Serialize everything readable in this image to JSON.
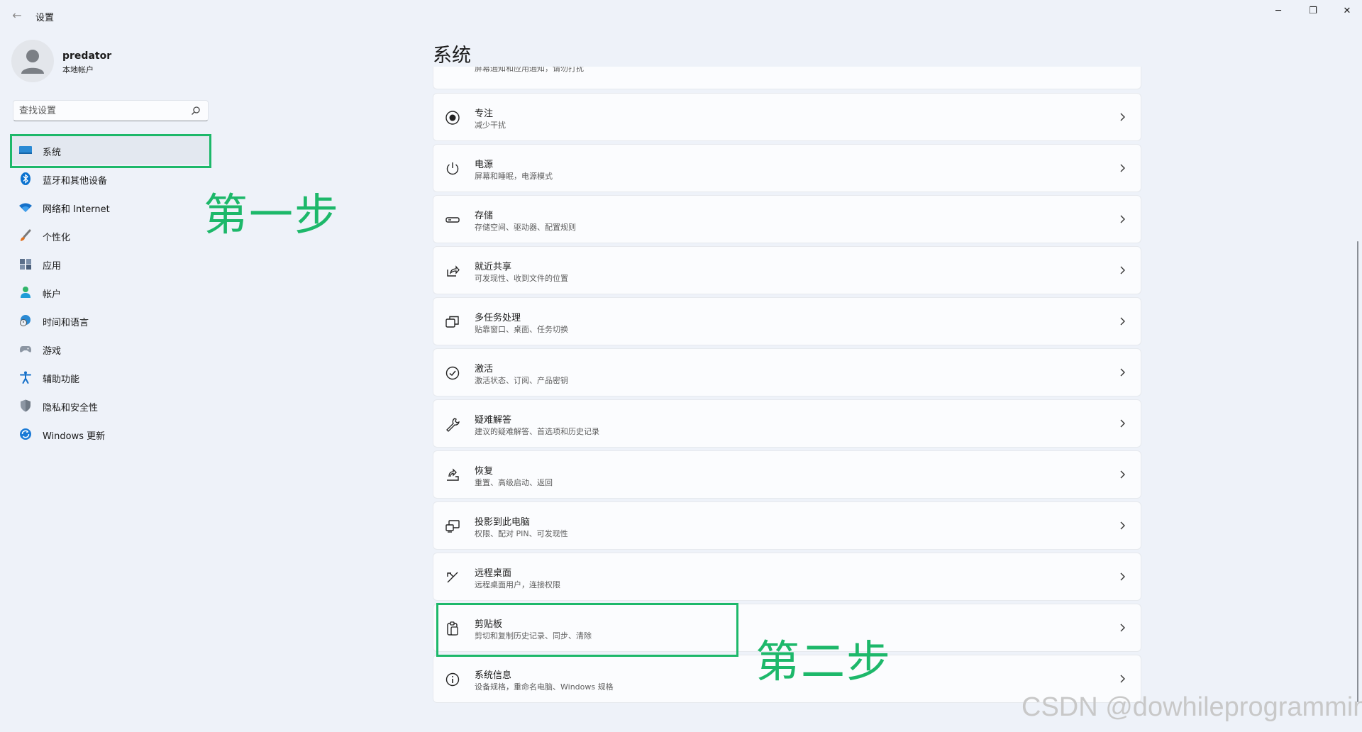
{
  "window": {
    "title": "设置",
    "minimize": "─",
    "maximize": "❐",
    "close": "✕"
  },
  "user": {
    "name": "predator",
    "account_type": "本地帐户"
  },
  "search": {
    "placeholder": "查找设置"
  },
  "sidebar": {
    "items": [
      {
        "label": "系统",
        "icon": "system-icon",
        "selected": true
      },
      {
        "label": "蓝牙和其他设备",
        "icon": "bluetooth-icon"
      },
      {
        "label": "网络和 Internet",
        "icon": "wifi-icon"
      },
      {
        "label": "个性化",
        "icon": "brush-icon"
      },
      {
        "label": "应用",
        "icon": "apps-icon"
      },
      {
        "label": "帐户",
        "icon": "account-icon"
      },
      {
        "label": "时间和语言",
        "icon": "globe-clock-icon"
      },
      {
        "label": "游戏",
        "icon": "gamepad-icon"
      },
      {
        "label": "辅助功能",
        "icon": "accessibility-icon"
      },
      {
        "label": "隐私和安全性",
        "icon": "shield-icon"
      },
      {
        "label": "Windows 更新",
        "icon": "update-icon"
      }
    ]
  },
  "main": {
    "title": "系统",
    "partial_desc": "屏幕通知和应用通知，请勿打扰",
    "cards": [
      {
        "title": "专注",
        "desc": "减少干扰",
        "icon": "focus-icon"
      },
      {
        "title": "电源",
        "desc": "屏幕和睡眠，电源模式",
        "icon": "power-icon"
      },
      {
        "title": "存储",
        "desc": "存储空间、驱动器、配置规则",
        "icon": "storage-icon"
      },
      {
        "title": "就近共享",
        "desc": "可发现性、收到文件的位置",
        "icon": "share-icon"
      },
      {
        "title": "多任务处理",
        "desc": "贴靠窗口、桌面、任务切换",
        "icon": "multitask-icon"
      },
      {
        "title": "激活",
        "desc": "激活状态、订阅、产品密钥",
        "icon": "activation-icon"
      },
      {
        "title": "疑难解答",
        "desc": "建议的疑难解答、首选项和历史记录",
        "icon": "wrench-icon"
      },
      {
        "title": "恢复",
        "desc": "重置、高级启动、返回",
        "icon": "recovery-icon"
      },
      {
        "title": "投影到此电脑",
        "desc": "权限、配对 PIN、可发现性",
        "icon": "projection-icon"
      },
      {
        "title": "远程桌面",
        "desc": "远程桌面用户，连接权限",
        "icon": "remote-icon"
      },
      {
        "title": "剪贴板",
        "desc": "剪切和复制历史记录、同步、清除",
        "icon": "clipboard-icon"
      },
      {
        "title": "系统信息",
        "desc": "设备规格，重命名电脑、Windows 规格",
        "icon": "info-icon"
      }
    ]
  },
  "annotations": {
    "step1": "第一步",
    "step2": "第二步"
  },
  "watermark": "CSDN @dowhileprogramming",
  "colors": {
    "background": "#eef2f9",
    "card": "#fbfcfe",
    "annotation": "#1db86a",
    "accent": "#0067c0"
  }
}
